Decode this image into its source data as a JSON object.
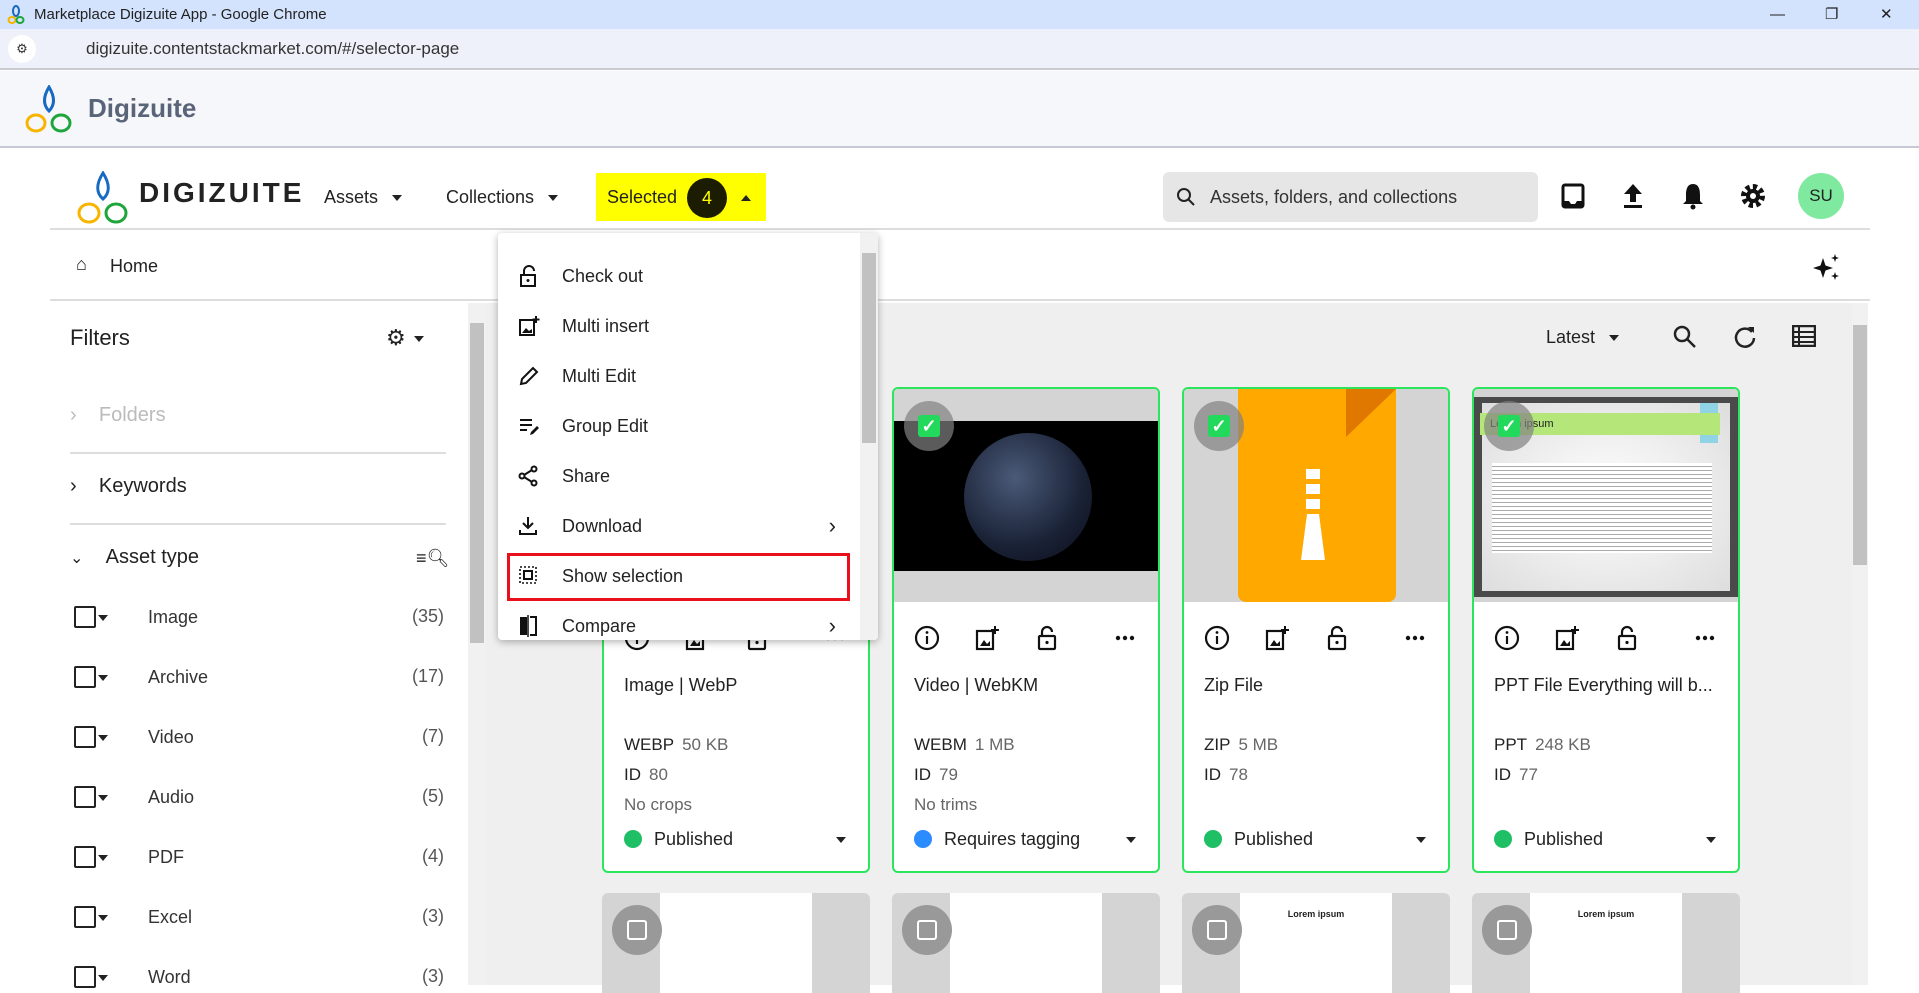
{
  "browser": {
    "title": "Marketplace Digizuite App - Google Chrome",
    "url": "digizuite.contentstackmarket.com/#/selector-page"
  },
  "app_header": {
    "name": "Digizuite"
  },
  "nav": {
    "logo_text": "DIGIZUITE",
    "assets": "Assets",
    "collections": "Collections",
    "selected_label": "Selected",
    "selected_count": "4",
    "search_placeholder": "Assets, folders, and collections",
    "avatar": "SU"
  },
  "breadcrumb": {
    "home": "Home"
  },
  "filters": {
    "title": "Filters",
    "folders": "Folders",
    "keywords": "Keywords",
    "asset_type": "Asset type",
    "types": [
      {
        "label": "Image",
        "count": "(35)"
      },
      {
        "label": "Archive",
        "count": "(17)"
      },
      {
        "label": "Video",
        "count": "(7)"
      },
      {
        "label": "Audio",
        "count": "(5)"
      },
      {
        "label": "PDF",
        "count": "(4)"
      },
      {
        "label": "Excel",
        "count": "(3)"
      },
      {
        "label": "Word",
        "count": "(3)"
      }
    ]
  },
  "toolbar": {
    "sort": "Latest"
  },
  "menu": {
    "items": [
      {
        "label": "Check out",
        "icon": "unlock-icon"
      },
      {
        "label": "Multi insert",
        "icon": "add-image-icon"
      },
      {
        "label": "Multi Edit",
        "icon": "pencil-icon"
      },
      {
        "label": "Group Edit",
        "icon": "group-edit-icon"
      },
      {
        "label": "Share",
        "icon": "share-icon"
      },
      {
        "label": "Download",
        "icon": "download-icon"
      },
      {
        "label": "Show selection",
        "icon": "selection-icon"
      },
      {
        "label": "Compare",
        "icon": "compare-icon"
      }
    ]
  },
  "cards": [
    {
      "title": "Image | WebP",
      "format": "WEBP",
      "size": "50 KB",
      "id_label": "ID",
      "id": "80",
      "note": "No crops",
      "status": "Published",
      "status_color": "#1fbf66"
    },
    {
      "title": "Video | WebKM",
      "format": "WEBM",
      "size": "1 MB",
      "id_label": "ID",
      "id": "79",
      "note": "No trims",
      "status": "Requires tagging",
      "status_color": "#2a8cff"
    },
    {
      "title": "Zip File",
      "format": "ZIP",
      "size": "5 MB",
      "id_label": "ID",
      "id": "78",
      "note": "",
      "status": "Published",
      "status_color": "#1fbf66"
    },
    {
      "title": "PPT File Everything will b...",
      "format": "PPT",
      "size": "248 KB",
      "id_label": "ID",
      "id": "77",
      "note": "",
      "status": "Published",
      "status_color": "#1fbf66",
      "thumb_text": "Lorem ipsum"
    }
  ],
  "row2": {
    "doc_heading": "Lorem ipsum"
  }
}
